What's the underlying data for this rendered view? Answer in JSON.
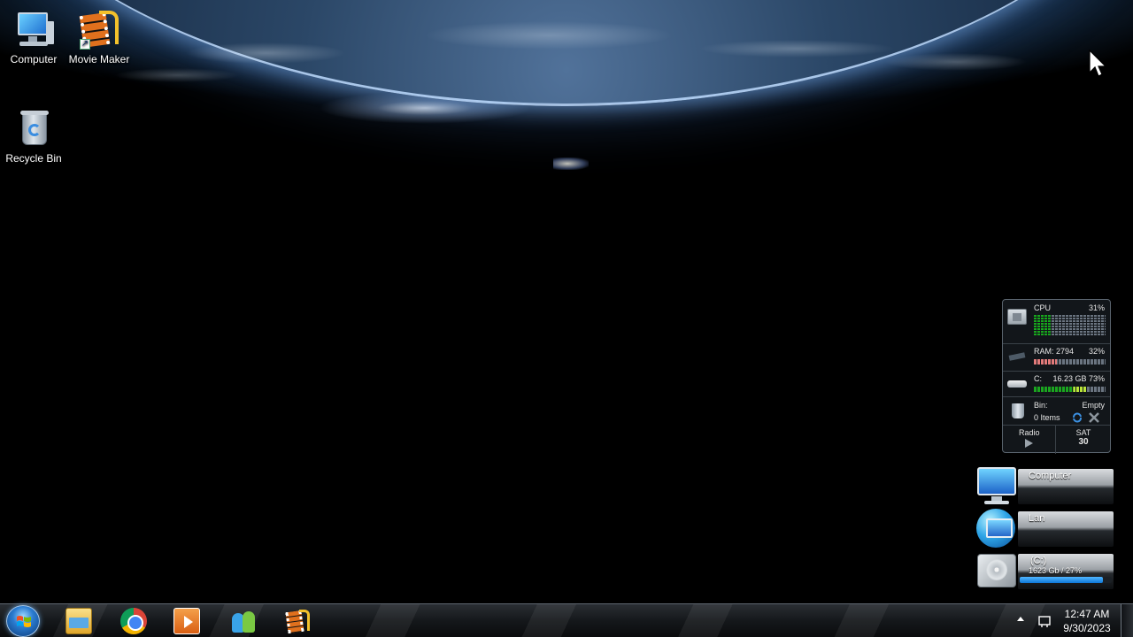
{
  "desktop": {
    "icons": [
      {
        "label": "Computer",
        "icon": "computer-icon"
      },
      {
        "label": "Movie Maker",
        "icon": "movie-maker-icon"
      },
      {
        "label": "Recycle Bin",
        "icon": "recycle-bin-icon"
      }
    ]
  },
  "sysmon": {
    "cpu_label": "CPU",
    "cpu_percent": "31%",
    "cpu_fill": 0.31,
    "ram_label": "RAM: 2794",
    "ram_percent": "32%",
    "ram_fill": 0.32,
    "disk_label": "C:",
    "disk_value": "16.23 GB 73%",
    "disk_fill": 0.73,
    "bin_label": "Bin:",
    "bin_action": "Empty",
    "bin_items": "0 Items",
    "radio_label": "Radio",
    "day_label": "SAT",
    "day_number": "30"
  },
  "tiles": {
    "computer": {
      "title": "Computer"
    },
    "lan": {
      "title": "Lan"
    },
    "drive": {
      "title": "(C:)",
      "subtitle": "1623 Gb / 27%",
      "fill": 0.9
    }
  },
  "taskbar": {
    "pinned": [
      "windows-explorer-icon",
      "google-chrome-icon",
      "media-player-icon",
      "messenger-icon",
      "movie-maker-icon"
    ],
    "clock_time": "12:47 AM",
    "clock_date": "9/30/2023"
  },
  "colors": {
    "cpu_green": "#17a81c",
    "ram_red": "#e27a7a",
    "accent_blue": "#0e78d8"
  }
}
